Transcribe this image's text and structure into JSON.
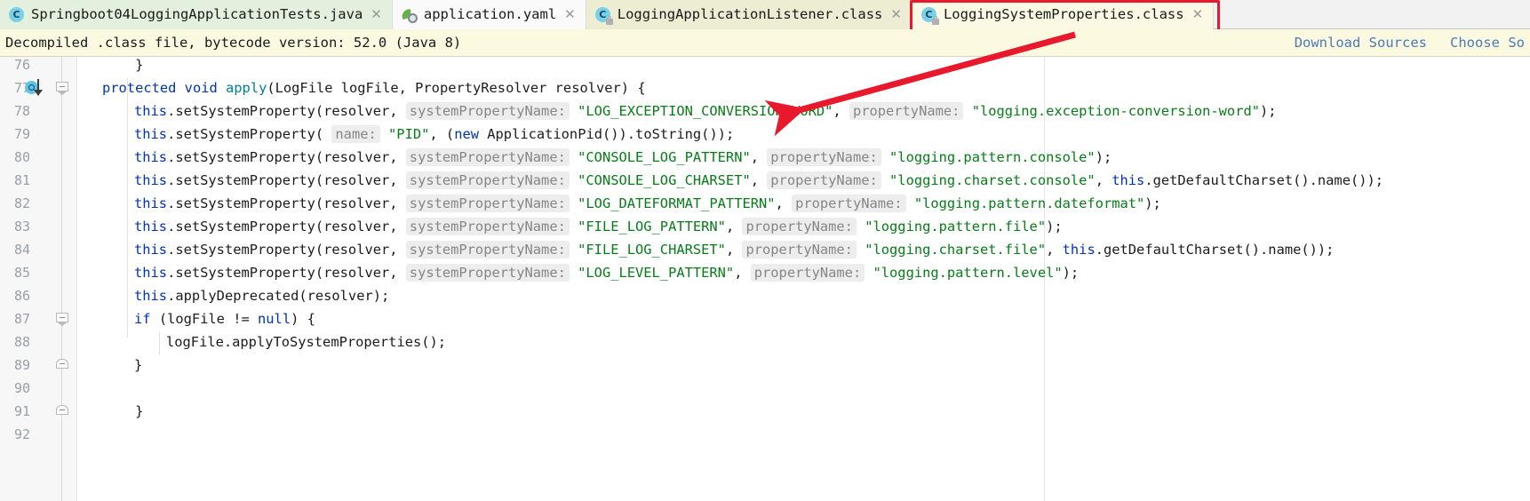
{
  "window": {
    "ide": "IntelliJ IDEA decompiled class viewer"
  },
  "tabs": [
    {
      "label": "Springboot04LoggingApplicationTests.java",
      "icon": "java-class-icon",
      "close": "✕",
      "state": "green"
    },
    {
      "label": "application.yaml",
      "icon": "yaml-file-icon",
      "close": "✕",
      "state": "white"
    },
    {
      "label": "LoggingApplicationListener.class",
      "icon": "java-class-readonly-icon",
      "close": "✕",
      "state": "yellow"
    },
    {
      "label": "LoggingSystemProperties.class",
      "icon": "java-class-readonly-icon",
      "close": "✕",
      "state": "active-highlighted"
    }
  ],
  "notification": {
    "message": "Decompiled .class file, bytecode version: 52.0 (Java 8)",
    "links": [
      "Download Sources",
      "Choose So"
    ]
  },
  "annotation": {
    "highlight_color": "#e8192c",
    "target_tab": "LoggingSystemProperties.class",
    "arrow_points_to_line": 78
  },
  "editor": {
    "gutter": {
      "line_numbers": [
        76,
        77,
        78,
        79,
        80,
        81,
        82,
        83,
        84,
        85,
        86,
        87,
        88,
        89,
        90,
        91,
        92
      ],
      "override_marker_line": 77,
      "fold_markers": [
        77,
        87,
        89,
        91
      ]
    },
    "lines": [
      {
        "num": 76,
        "indent": 0,
        "tokens": [
          {
            "t": "plain",
            "v": "    }"
          }
        ]
      },
      {
        "num": 77,
        "indent": 0,
        "tokens": [
          {
            "t": "kw",
            "v": "protected "
          },
          {
            "t": "kw",
            "v": "void "
          },
          {
            "t": "meth",
            "v": "apply"
          },
          {
            "t": "plain",
            "v": "(LogFile logFile, PropertyResolver resolver) {"
          }
        ]
      },
      {
        "num": 78,
        "indent": 1,
        "tokens": [
          {
            "t": "kw",
            "v": "this"
          },
          {
            "t": "plain",
            "v": ".setSystemProperty(resolver, "
          },
          {
            "t": "hint",
            "v": "systemPropertyName:"
          },
          {
            "t": "plain",
            "v": " "
          },
          {
            "t": "str",
            "v": "\"LOG_EXCEPTION_CONVERSION_WORD\""
          },
          {
            "t": "plain",
            "v": ", "
          },
          {
            "t": "hint",
            "v": "propertyName:"
          },
          {
            "t": "plain",
            "v": " "
          },
          {
            "t": "str",
            "v": "\"logging.exception-conversion-word\""
          },
          {
            "t": "plain",
            "v": ");"
          }
        ]
      },
      {
        "num": 79,
        "indent": 1,
        "tokens": [
          {
            "t": "kw",
            "v": "this"
          },
          {
            "t": "plain",
            "v": ".setSystemProperty( "
          },
          {
            "t": "hint",
            "v": "name:"
          },
          {
            "t": "plain",
            "v": " "
          },
          {
            "t": "str",
            "v": "\"PID\""
          },
          {
            "t": "plain",
            "v": ", ("
          },
          {
            "t": "kw",
            "v": "new"
          },
          {
            "t": "plain",
            "v": " ApplicationPid()).toString());"
          }
        ]
      },
      {
        "num": 80,
        "indent": 1,
        "tokens": [
          {
            "t": "kw",
            "v": "this"
          },
          {
            "t": "plain",
            "v": ".setSystemProperty(resolver, "
          },
          {
            "t": "hint",
            "v": "systemPropertyName:"
          },
          {
            "t": "plain",
            "v": " "
          },
          {
            "t": "str",
            "v": "\"CONSOLE_LOG_PATTERN\""
          },
          {
            "t": "plain",
            "v": ", "
          },
          {
            "t": "hint",
            "v": "propertyName:"
          },
          {
            "t": "plain",
            "v": " "
          },
          {
            "t": "str",
            "v": "\"logging.pattern.console\""
          },
          {
            "t": "plain",
            "v": ");"
          }
        ]
      },
      {
        "num": 81,
        "indent": 1,
        "tokens": [
          {
            "t": "kw",
            "v": "this"
          },
          {
            "t": "plain",
            "v": ".setSystemProperty(resolver, "
          },
          {
            "t": "hint",
            "v": "systemPropertyName:"
          },
          {
            "t": "plain",
            "v": " "
          },
          {
            "t": "str",
            "v": "\"CONSOLE_LOG_CHARSET\""
          },
          {
            "t": "plain",
            "v": ", "
          },
          {
            "t": "hint",
            "v": "propertyName:"
          },
          {
            "t": "plain",
            "v": " "
          },
          {
            "t": "str",
            "v": "\"logging.charset.console\""
          },
          {
            "t": "plain",
            "v": ", "
          },
          {
            "t": "kw",
            "v": "this"
          },
          {
            "t": "plain",
            "v": ".getDefaultCharset().name());"
          }
        ]
      },
      {
        "num": 82,
        "indent": 1,
        "tokens": [
          {
            "t": "kw",
            "v": "this"
          },
          {
            "t": "plain",
            "v": ".setSystemProperty(resolver, "
          },
          {
            "t": "hint",
            "v": "systemPropertyName:"
          },
          {
            "t": "plain",
            "v": " "
          },
          {
            "t": "str",
            "v": "\"LOG_DATEFORMAT_PATTERN\""
          },
          {
            "t": "plain",
            "v": ", "
          },
          {
            "t": "hint",
            "v": "propertyName:"
          },
          {
            "t": "plain",
            "v": " "
          },
          {
            "t": "str",
            "v": "\"logging.pattern.dateformat\""
          },
          {
            "t": "plain",
            "v": ");"
          }
        ]
      },
      {
        "num": 83,
        "indent": 1,
        "tokens": [
          {
            "t": "kw",
            "v": "this"
          },
          {
            "t": "plain",
            "v": ".setSystemProperty(resolver, "
          },
          {
            "t": "hint",
            "v": "systemPropertyName:"
          },
          {
            "t": "plain",
            "v": " "
          },
          {
            "t": "str",
            "v": "\"FILE_LOG_PATTERN\""
          },
          {
            "t": "plain",
            "v": ", "
          },
          {
            "t": "hint",
            "v": "propertyName:"
          },
          {
            "t": "plain",
            "v": " "
          },
          {
            "t": "str",
            "v": "\"logging.pattern.file\""
          },
          {
            "t": "plain",
            "v": ");"
          }
        ]
      },
      {
        "num": 84,
        "indent": 1,
        "tokens": [
          {
            "t": "kw",
            "v": "this"
          },
          {
            "t": "plain",
            "v": ".setSystemProperty(resolver, "
          },
          {
            "t": "hint",
            "v": "systemPropertyName:"
          },
          {
            "t": "plain",
            "v": " "
          },
          {
            "t": "str",
            "v": "\"FILE_LOG_CHARSET\""
          },
          {
            "t": "plain",
            "v": ", "
          },
          {
            "t": "hint",
            "v": "propertyName:"
          },
          {
            "t": "plain",
            "v": " "
          },
          {
            "t": "str",
            "v": "\"logging.charset.file\""
          },
          {
            "t": "plain",
            "v": ", "
          },
          {
            "t": "kw",
            "v": "this"
          },
          {
            "t": "plain",
            "v": ".getDefaultCharset().name());"
          }
        ]
      },
      {
        "num": 85,
        "indent": 1,
        "tokens": [
          {
            "t": "kw",
            "v": "this"
          },
          {
            "t": "plain",
            "v": ".setSystemProperty(resolver, "
          },
          {
            "t": "hint",
            "v": "systemPropertyName:"
          },
          {
            "t": "plain",
            "v": " "
          },
          {
            "t": "str",
            "v": "\"LOG_LEVEL_PATTERN\""
          },
          {
            "t": "plain",
            "v": ", "
          },
          {
            "t": "hint",
            "v": "propertyName:"
          },
          {
            "t": "plain",
            "v": " "
          },
          {
            "t": "str",
            "v": "\"logging.pattern.level\""
          },
          {
            "t": "plain",
            "v": ");"
          }
        ]
      },
      {
        "num": 86,
        "indent": 1,
        "tokens": [
          {
            "t": "kw",
            "v": "this"
          },
          {
            "t": "plain",
            "v": ".applyDeprecated(resolver);"
          }
        ]
      },
      {
        "num": 87,
        "indent": 1,
        "tokens": [
          {
            "t": "kw",
            "v": "if"
          },
          {
            "t": "plain",
            "v": " (logFile != "
          },
          {
            "t": "kw",
            "v": "null"
          },
          {
            "t": "plain",
            "v": ") {"
          }
        ]
      },
      {
        "num": 88,
        "indent": 2,
        "tokens": [
          {
            "t": "plain",
            "v": "logFile.applyToSystemProperties();"
          }
        ]
      },
      {
        "num": 89,
        "indent": 1,
        "tokens": [
          {
            "t": "plain",
            "v": "}"
          }
        ]
      },
      {
        "num": 90,
        "indent": 0,
        "tokens": []
      },
      {
        "num": 91,
        "indent": 0,
        "tokens": [
          {
            "t": "plain",
            "v": "    }"
          }
        ]
      },
      {
        "num": 92,
        "indent": 0,
        "tokens": []
      }
    ]
  },
  "colors": {
    "keyword": "#0033b3",
    "string": "#067d17",
    "method": "#00809d",
    "hint_text": "#868686",
    "hint_bg": "#ededed",
    "notif_bg": "#fcf9e1",
    "link": "#4c79b8",
    "tab_green": "#e3f0dd",
    "tab_yellow": "#ecedd2",
    "annotation_red": "#e8192c"
  }
}
